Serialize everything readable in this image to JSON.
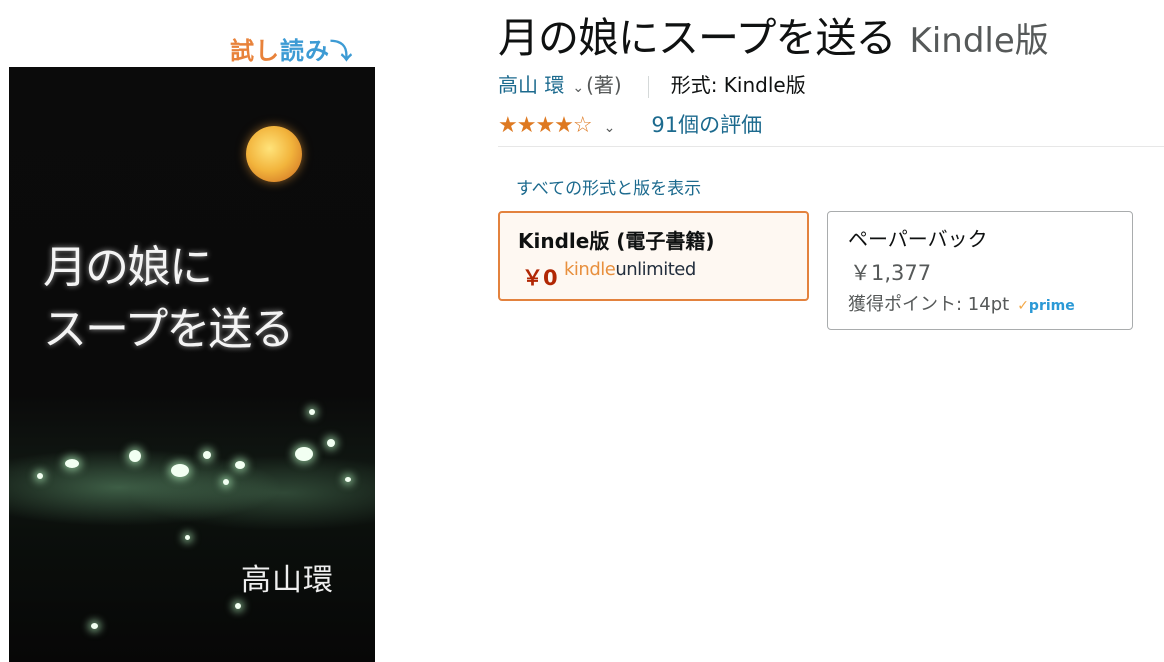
{
  "look_inside": {
    "part_a": "試し",
    "part_b": "読み",
    "arrow": "⤵"
  },
  "cover": {
    "title_line1": "月の娘に",
    "title_line2": "スープを送る",
    "author": "高山環"
  },
  "product": {
    "title": "月の娘にスープを送る",
    "format_suffix": "Kindle版",
    "author_name": "高山 環",
    "author_role": "(著)",
    "format_label": "形式: Kindle版",
    "rating": {
      "stars_text": "★★★★☆",
      "value_stars": 4,
      "count_text": "91個の評価"
    },
    "all_formats_link": "すべての形式と版を表示"
  },
  "formats": [
    {
      "name": "Kindle版 (電子書籍)",
      "price": "￥0",
      "badge_a": "kindle",
      "badge_b": "unlimited",
      "selected": true
    },
    {
      "name": "ペーパーバック",
      "price": "￥1,377",
      "points": "獲得ポイント: 14pt",
      "prime": "prime",
      "selected": false
    }
  ],
  "colors": {
    "link": "#1c6a8e",
    "star": "#de7921",
    "selected_border": "#e3823e",
    "price_red": "#b12704",
    "prime_blue": "#2b99d6"
  }
}
